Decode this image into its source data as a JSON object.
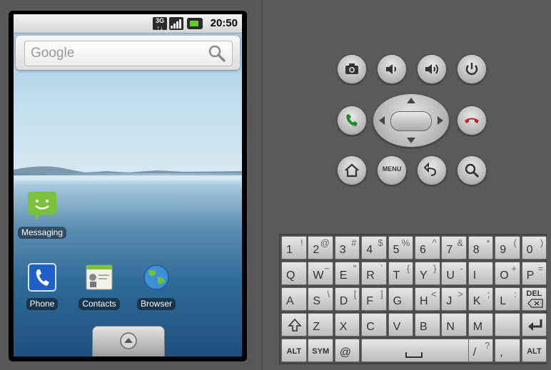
{
  "status_bar": {
    "network": "3G",
    "time": "20:50"
  },
  "search": {
    "logo": "Google",
    "icon": "magnifier-icon"
  },
  "home_apps": [
    {
      "label": "Messaging",
      "icon": "messaging-icon"
    },
    {
      "label": "Phone",
      "icon": "phone-icon"
    },
    {
      "label": "Contacts",
      "icon": "contacts-icon"
    },
    {
      "label": "Browser",
      "icon": "browser-icon"
    }
  ],
  "controls": {
    "menu_label": "MENU",
    "buttons": [
      "camera-icon",
      "volume-down-icon",
      "volume-up-icon",
      "power-icon",
      "call-icon",
      "dpad",
      "end-call-icon",
      "home-icon",
      "menu-button",
      "back-icon",
      "search-icon"
    ]
  },
  "keyboard": {
    "rows": [
      [
        [
          "1",
          "!"
        ],
        [
          "2",
          "@"
        ],
        [
          "3",
          "#"
        ],
        [
          "4",
          "$"
        ],
        [
          "5",
          "%"
        ],
        [
          "6",
          "^"
        ],
        [
          "7",
          "&"
        ],
        [
          "8",
          "*"
        ],
        [
          "9",
          "("
        ],
        [
          "0",
          ")"
        ]
      ],
      [
        [
          "Q",
          ""
        ],
        [
          "W",
          "~"
        ],
        [
          "E",
          "\""
        ],
        [
          "R",
          "`"
        ],
        [
          "T",
          "{"
        ],
        [
          "Y",
          "}"
        ],
        [
          "U",
          "-"
        ],
        [
          "I",
          ""
        ],
        [
          "O",
          "+"
        ],
        [
          "P",
          "="
        ]
      ],
      [
        [
          "A",
          ""
        ],
        [
          "S",
          "\\"
        ],
        [
          "D",
          "["
        ],
        [
          "F",
          "]"
        ],
        [
          "G",
          ""
        ],
        [
          "H",
          "<"
        ],
        [
          "J",
          ">"
        ],
        [
          "K",
          ";"
        ],
        [
          "L",
          ":"
        ],
        [
          "DEL",
          ""
        ]
      ],
      [
        [
          "shift",
          ""
        ],
        [
          "Z",
          ""
        ],
        [
          "X",
          ""
        ],
        [
          "C",
          ""
        ],
        [
          "V",
          ""
        ],
        [
          "B",
          ""
        ],
        [
          "N",
          ""
        ],
        [
          "M",
          ""
        ],
        [
          "",
          ""
        ],
        [
          "enter",
          ""
        ]
      ]
    ],
    "bottom": {
      "alt_left": "ALT",
      "sym": "SYM",
      "at": "@",
      "slash": "/",
      "question": "?",
      "comma": ",",
      "alt_right": "ALT"
    }
  }
}
